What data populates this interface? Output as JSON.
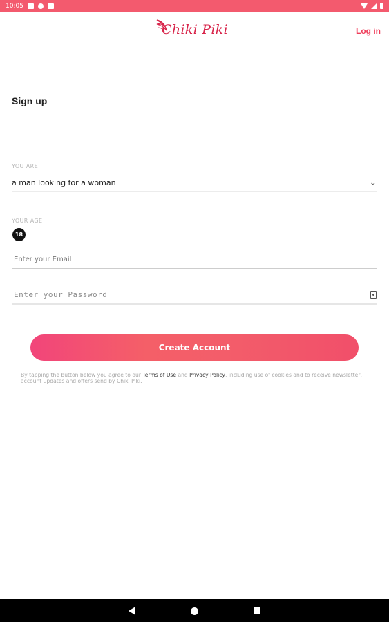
{
  "status_bar": {
    "time": "10:05",
    "icons": [
      "mail-icon",
      "app-icon",
      "square-icon",
      "wifi-icon",
      "signal-icon",
      "battery-icon"
    ],
    "color": "#f35a6e"
  },
  "header": {
    "logo_text": "Chiki Piki",
    "login_label": "Log in",
    "accent": "#ef3d5a"
  },
  "page": {
    "title": "Sign up"
  },
  "form": {
    "you_are_label": "YOU ARE",
    "you_are_value": "a man looking for a woman",
    "age_label": "YOUR AGE",
    "age_value": "18",
    "email_placeholder": "Enter your Email",
    "password_placeholder": "Enter your Password",
    "submit_label": "Create Account"
  },
  "legal": {
    "prefix": "By tapping the button below you agree to our ",
    "terms_link": "Terms of Use",
    "and": " and ",
    "privacy_link": "Privacy Policy",
    "suffix": ", including use of cookies and to receive newsletter, account updates and offers send by Chiki Piki."
  },
  "nav_bar": {
    "icons": [
      "back-icon",
      "home-icon",
      "recents-icon"
    ]
  }
}
